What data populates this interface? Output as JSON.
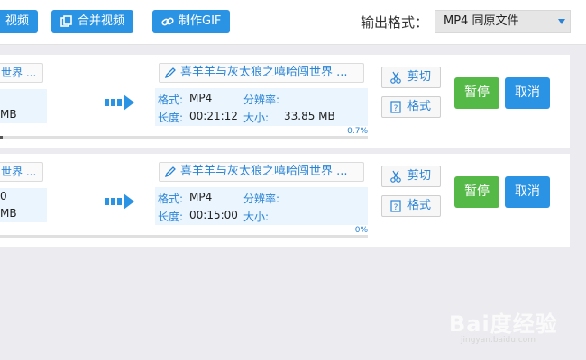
{
  "toolbar": {
    "buttons": [
      {
        "label": "视频"
      },
      {
        "label": "合并视频"
      },
      {
        "label": "制作GIF"
      }
    ],
    "format_label": "输出格式：",
    "format_value": "MP4  同原文件"
  },
  "tasks": [
    {
      "src_name": "世界 ...",
      "src_line1": "",
      "src_line2": "MB",
      "out_name": "喜羊羊与灰太狼之嘻哈闯世界 ...",
      "format_key": "格式:",
      "format_val": "MP4",
      "res_key": "分辨率:",
      "res_val": "",
      "dur_key": "长度:",
      "dur_val": "00:21:12",
      "size_key": "大小:",
      "size_val": "33.85 MB",
      "progress": 0.7,
      "progress_text": "0.7%",
      "cut_label": "剪切",
      "format_btn": "格式",
      "pause_label": "暂停",
      "cancel_label": "取消"
    },
    {
      "src_name": "世界 ...",
      "src_line1": "0",
      "src_line2": "MB",
      "out_name": "喜羊羊与灰太狼之嘻哈闯世界 ...",
      "format_key": "格式:",
      "format_val": "MP4",
      "res_key": "分辨率:",
      "res_val": "",
      "dur_key": "长度:",
      "dur_val": "00:15:00",
      "size_key": "大小:",
      "size_val": "",
      "progress": 0,
      "progress_text": "0%",
      "cut_label": "剪切",
      "format_btn": "格式",
      "pause_label": "暂停",
      "cancel_label": "取消"
    }
  ],
  "watermark": {
    "logo": "Bai度经验",
    "url": "jingyan.baidu.com"
  },
  "colors": {
    "accent": "#2a93e3",
    "pause": "#54b947",
    "info_bg": "#eaf5fd"
  }
}
